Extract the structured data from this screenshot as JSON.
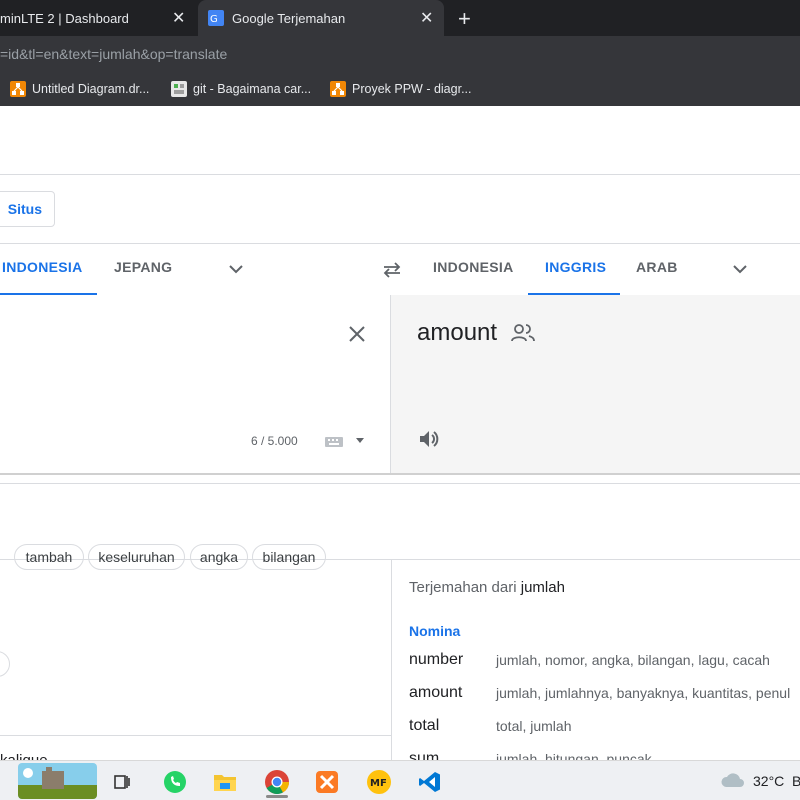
{
  "tabs": [
    {
      "title": "minLTE 2 | Dashboard",
      "active": false
    },
    {
      "title": "Google Terjemahan",
      "active": true
    }
  ],
  "address": "=id&tl=en&text=jumlah&op=translate",
  "bookmarks": [
    {
      "label": "Untitled Diagram.dr...",
      "icon": "drawio-icon"
    },
    {
      "label": "git - Bagaimana car...",
      "icon": "stackoverflow-icon"
    },
    {
      "label": "Proyek PPW - diagr...",
      "icon": "drawio-icon"
    }
  ],
  "translate": {
    "situs_label": "Situs",
    "source_langs": [
      "INDONESIA",
      "JEPANG"
    ],
    "target_langs": [
      "INDONESIA",
      "INGGRIS",
      "ARAB"
    ],
    "result": "amount",
    "char_count": "6 / 5.000",
    "related_chips": [
      "tambah",
      "keseluruhan",
      "angka",
      "bilangan"
    ],
    "partial_text": "kalique"
  },
  "dictionary": {
    "header_prefix": "Terjemahan dari",
    "header_word": "jumlah",
    "pos": "Nomina",
    "entries": [
      {
        "word": "number",
        "synonyms": "jumlah, nomor, angka, bilangan, lagu, cacah"
      },
      {
        "word": "amount",
        "synonyms": "jumlah, jumlahnya, banyaknya, kuantitas, penul"
      },
      {
        "word": "total",
        "synonyms": "total, jumlah"
      },
      {
        "word": "sum",
        "synonyms": "jumlah, hitungan, puncak"
      }
    ]
  },
  "taskbar": {
    "weather": "32°C",
    "weather_suffix": "B"
  },
  "colors": {
    "accent": "#1a73e8",
    "chrome_dark": "#202124",
    "chrome_mid": "#35363a"
  }
}
